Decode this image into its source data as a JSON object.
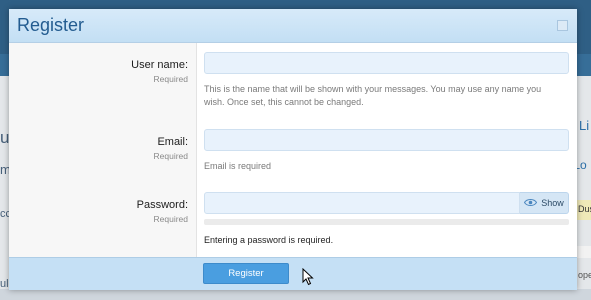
{
  "background": {
    "fragments": [
      "u",
      "m",
      "cc",
      "ul",
      "Li",
      "r/Lo",
      "Dus",
      "ope"
    ]
  },
  "modal": {
    "title": "Register",
    "fields": {
      "username": {
        "label": "User name:",
        "hint": "Required",
        "value": "",
        "explain_line1": "This is the name that will be shown with your messages. You may use any name you",
        "explain_line2": "wish. Once set, this cannot be changed."
      },
      "email": {
        "label": "Email:",
        "hint": "Required",
        "value": "",
        "error": "Email is required"
      },
      "password": {
        "label": "Password:",
        "hint": "Required",
        "value": "",
        "show_label": "Show",
        "error": "Entering a password is required."
      }
    },
    "footer": {
      "register_label": "Register"
    }
  },
  "icons": {
    "close": "close-icon",
    "eye": "eye-icon",
    "cursor": "mouse-pointer-icon"
  },
  "colors": {
    "header_text": "#235c90",
    "input_fill": "#e8f2fc",
    "button": "#4a9ee0",
    "footer": "#c5e0f5"
  }
}
